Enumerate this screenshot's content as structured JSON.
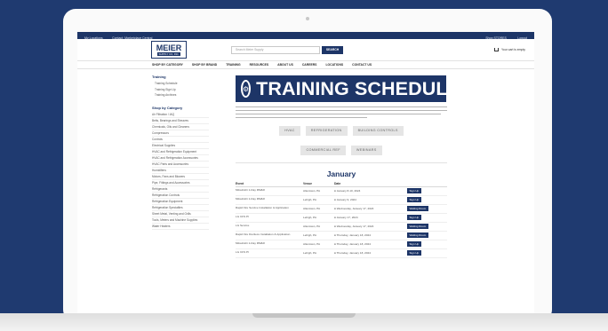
{
  "topbar": {
    "links": [
      "My Locations",
      "Contact: Marketplace Central"
    ],
    "account": [
      "Shop STORES",
      "Logout"
    ]
  },
  "header": {
    "logo_main": "MEIER",
    "logo_sub": "SUPPLY CO, INC.",
    "search_placeholder": "Search Meier Supply",
    "search_button": "SEARCH",
    "cart_label": "Your cart is empty"
  },
  "nav": [
    "SHOP BY CATEGORY",
    "SHOP BY BRAND",
    "TRAINING",
    "RESOURCES",
    "ABOUT US",
    "CAREERS",
    "LOCATIONS",
    "CONTACT US"
  ],
  "sidebar": {
    "training_title": "Training",
    "training_items": [
      "Training Schedule",
      "Training Sign Up",
      "Training Archives"
    ],
    "category_title": "Shop by Category",
    "categories": [
      "Air Filtration / IAQ",
      "Belts, Bearings and Sheaves",
      "Chemicals, Oils and Cleaners",
      "Compressors",
      "Controls",
      "Electrical Supplies",
      "HVAC and Refrigeration Equipment",
      "HVAC and Refrigeration Accessories",
      "HVAC Parts and Accessories",
      "Humidifiers",
      "Motors, Fans and Blowers",
      "Pipe, Fittings and Accessories",
      "Refrigerants",
      "Refrigeration Controls",
      "Refrigeration Equipment",
      "Refrigeration Specialties",
      "Sheet Metal, Venting and Grills",
      "Tools, Meters and Machine Supplies",
      "Water Heaters"
    ]
  },
  "main": {
    "banner_title": "TRAINING SCHEDULE",
    "filters_row1": [
      "HVAC",
      "REFRIGERATION",
      "BUILDING CONTROLS"
    ],
    "filters_row2": [
      "COMMERCIAL REF",
      "WEBINARS"
    ],
    "month": "January",
    "table_headers": [
      "Event",
      "Venue",
      "Date",
      ""
    ],
    "rows": [
      {
        "event": "Mitsubishi 1-Day RM&R",
        "venue": "Allentown, PA",
        "date": "January 8-10, 2024",
        "action": "Sign Up"
      },
      {
        "event": "Mitsubishi 1-Day RM&R",
        "venue": "Lehigh, PA",
        "date": "January 9, 2024",
        "action": "Sign Up"
      },
      {
        "event": "Rapid Fire Service Installation & Application",
        "venue": "Allentown, PA",
        "date": "Wednesday, January 17, 2024",
        "action": "Waiting Room"
      },
      {
        "event": "LG CFS PI",
        "venue": "Lehigh, PA",
        "date": "January 17, 2024",
        "action": "Sign Up"
      },
      {
        "event": "LG Service",
        "venue": "Allentown, PA",
        "date": "Wednesday, January 17, 2024",
        "action": "Waiting Room"
      },
      {
        "event": "Rapid Fire Ductless Installation & Application",
        "venue": "Lehigh, PA",
        "date": "Thursday, January 18, 2024",
        "action": "Waiting Room"
      },
      {
        "event": "Mitsubishi 1-Day RM&R",
        "venue": "Allentown, PA",
        "date": "Thursday, January 18, 2024",
        "action": "Sign Up"
      },
      {
        "event": "LG CFS PI",
        "venue": "Lehigh, PA",
        "date": "Thursday, January 18, 2024",
        "action": "Sign Up"
      }
    ]
  }
}
